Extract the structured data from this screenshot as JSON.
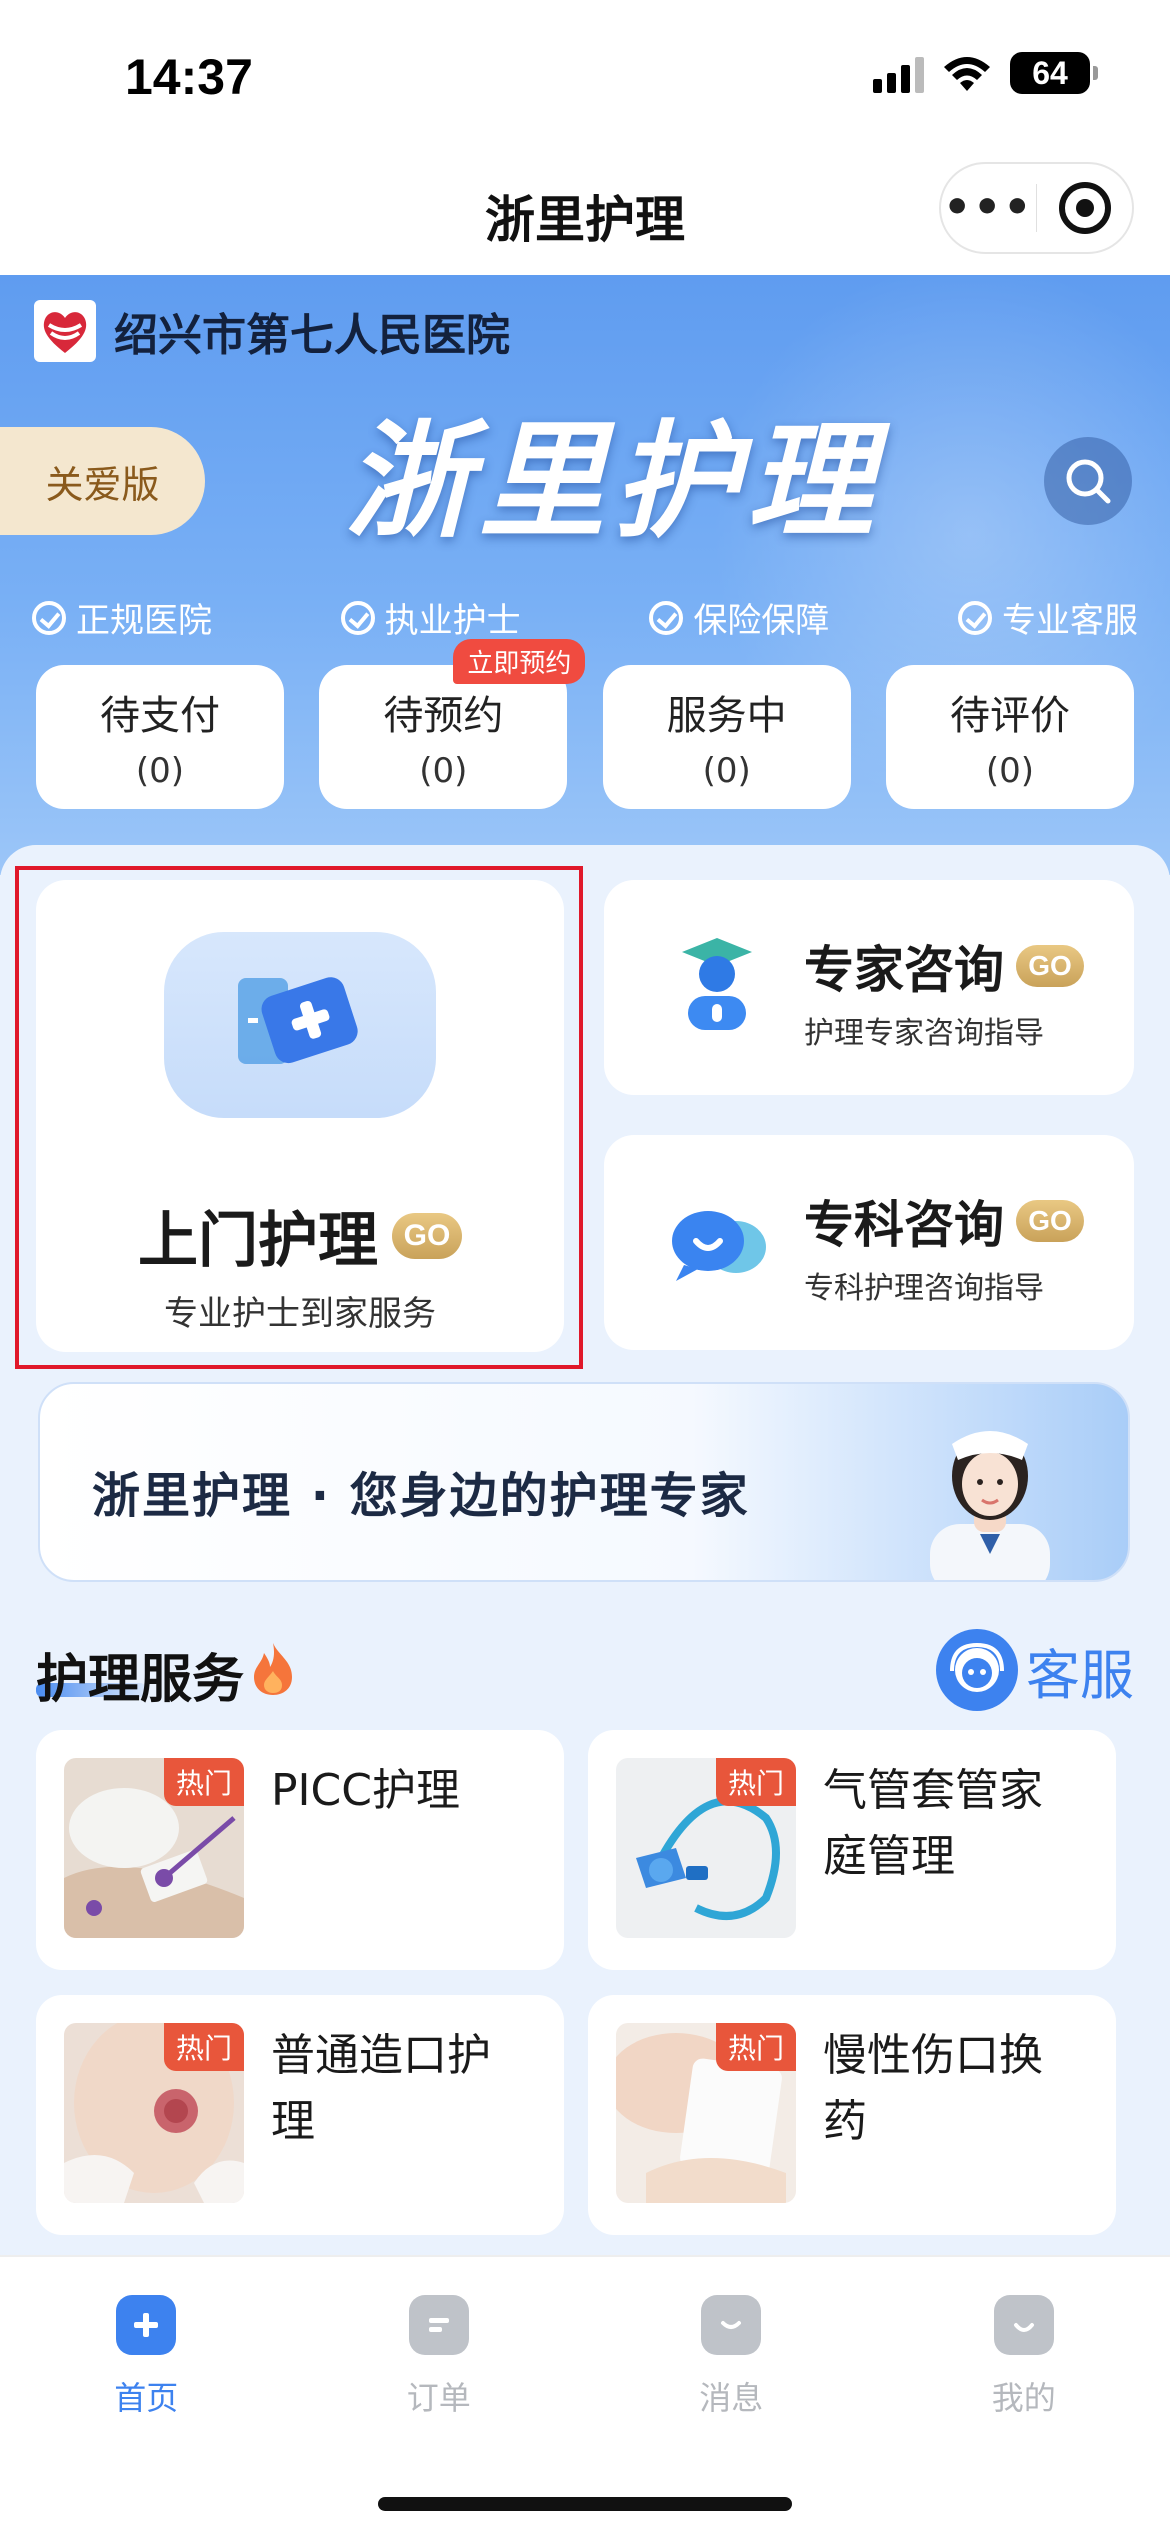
{
  "status_bar": {
    "time": "14:37",
    "battery": "64"
  },
  "app_bar": {
    "title": "浙里护理"
  },
  "hero": {
    "hospital_name": "绍兴市第七人民医院",
    "care_mode_label": "关爱版",
    "title": "浙里护理",
    "badges": [
      "正规医院",
      "执业护士",
      "保险保障",
      "专业客服"
    ]
  },
  "orders": [
    {
      "label": "待支付",
      "count": "(0)"
    },
    {
      "label": "待预约",
      "count": "(0)",
      "tag": "立即预约"
    },
    {
      "label": "服务中",
      "count": "(0)"
    },
    {
      "label": "待评价",
      "count": "(0)"
    }
  ],
  "home_care": {
    "title": "上门护理",
    "go": "GO",
    "subtitle": "专业护士到家服务"
  },
  "expert_consult": {
    "title": "专家咨询",
    "go": "GO",
    "subtitle": "护理专家咨询指导"
  },
  "specialty_consult": {
    "title": "专科咨询",
    "go": "GO",
    "subtitle": "专科护理咨询指导"
  },
  "banner": {
    "text": "浙里护理 · 您身边的护理专家"
  },
  "section": {
    "title": "护理服务",
    "customer_service": "客服"
  },
  "services": [
    {
      "name": "PICC护理",
      "tag": "热门"
    },
    {
      "name": "气管套管家庭管理",
      "tag": "热门"
    },
    {
      "name": "普通造口护理",
      "tag": "热门"
    },
    {
      "name": "慢性伤口换药",
      "tag": "热门"
    }
  ],
  "tabs": [
    {
      "label": "首页",
      "icon": "home-plus-icon",
      "active": true
    },
    {
      "label": "订单",
      "icon": "order-icon",
      "active": false
    },
    {
      "label": "消息",
      "icon": "message-icon",
      "active": false
    },
    {
      "label": "我的",
      "icon": "profile-icon",
      "active": false
    }
  ],
  "colors": {
    "primary": "#3d82ef",
    "gold": "#c9a25a",
    "hot": "#e8563b",
    "highlight_box": "#e0182a"
  }
}
